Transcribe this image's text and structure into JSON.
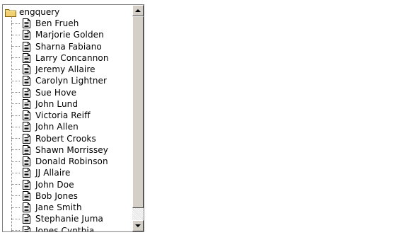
{
  "tree": {
    "root_label": "engquery",
    "root_icon": "folder-icon",
    "item_icon": "document-icon",
    "items": [
      {
        "label": "Ben Frueh"
      },
      {
        "label": "Marjorie Golden"
      },
      {
        "label": "Sharna Fabiano"
      },
      {
        "label": "Larry Concannon"
      },
      {
        "label": "Jeremy Allaire"
      },
      {
        "label": "Carolyn Lightner"
      },
      {
        "label": "Sue Hove"
      },
      {
        "label": "John Lund"
      },
      {
        "label": "Victoria Reiff"
      },
      {
        "label": "John Allen"
      },
      {
        "label": "Robert Crooks"
      },
      {
        "label": "Shawn Morrissey"
      },
      {
        "label": "Donald Robinson"
      },
      {
        "label": "JJ Allaire"
      },
      {
        "label": "John Doe"
      },
      {
        "label": "Bob Jones"
      },
      {
        "label": "Jane Smith"
      },
      {
        "label": "Stephanie Juma"
      },
      {
        "label": "Jones Cynthia"
      }
    ]
  },
  "scrollbar": {
    "orientation": "vertical",
    "position_fraction": 0.0,
    "visible_fraction": 0.94
  },
  "colors": {
    "folder": "#f0d070",
    "border": "#808080",
    "scroll_face": "#d4d0c8"
  }
}
